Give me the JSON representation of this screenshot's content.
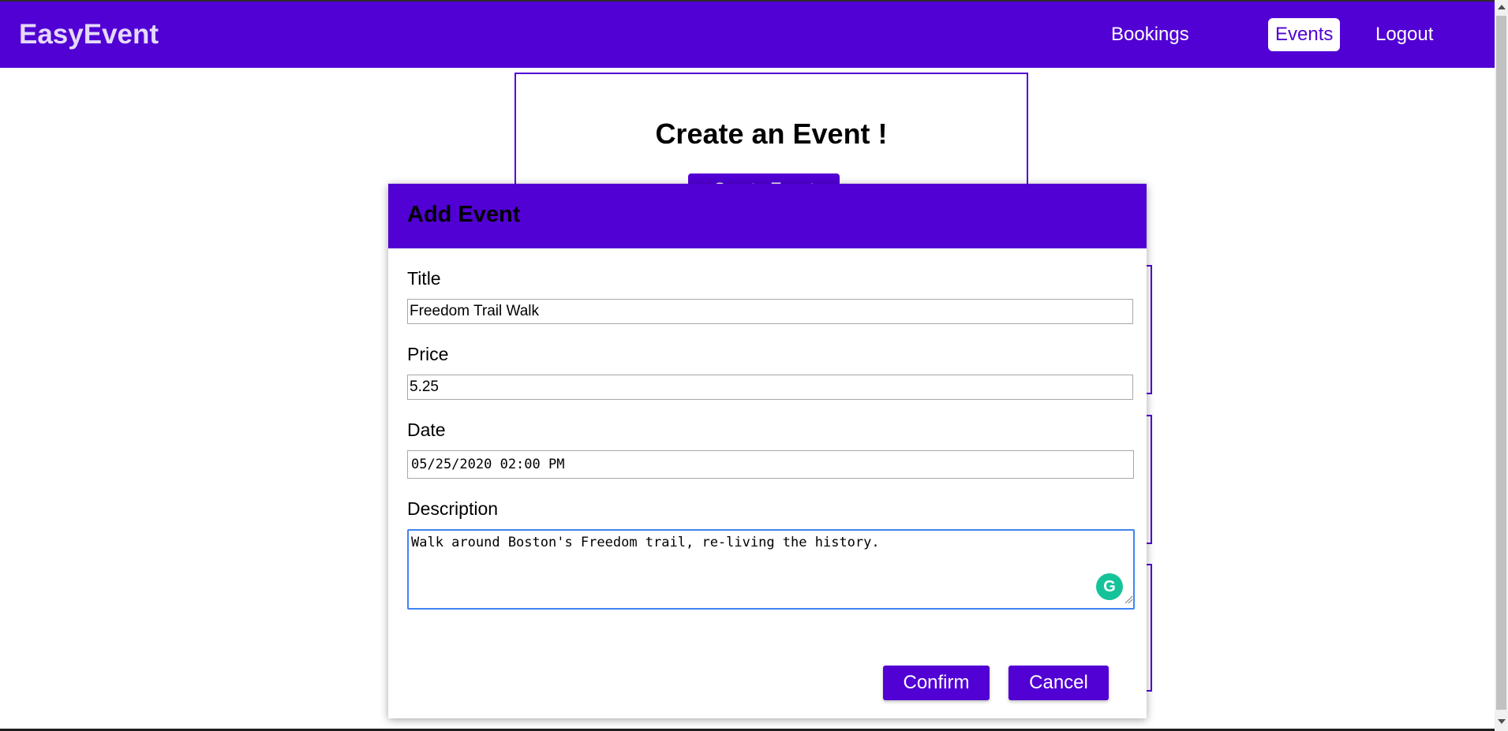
{
  "navbar": {
    "brand": "EasyEvent",
    "items": [
      {
        "label": "Bookings",
        "active": false
      },
      {
        "label": "Events",
        "active": true
      },
      {
        "label": "Logout",
        "active": false
      }
    ]
  },
  "hero": {
    "title": "Create an Event !",
    "button_label": "Create Event"
  },
  "modal": {
    "title": "Add Event",
    "fields": {
      "title": {
        "label": "Title",
        "value": "Freedom Trail Walk"
      },
      "price": {
        "label": "Price",
        "value": "5.25"
      },
      "date": {
        "label": "Date",
        "value": "05/25/2020 02:00 PM"
      },
      "description": {
        "label": "Description",
        "value": "Walk around Boston's Freedom trail, re-living the history."
      }
    },
    "confirm_label": "Confirm",
    "cancel_label": "Cancel"
  },
  "icons": {
    "grammarly": "grammarly-icon"
  },
  "colors": {
    "accent": "#5101d3",
    "focus": "#3f85f3",
    "grammarly": "#15c39a"
  }
}
